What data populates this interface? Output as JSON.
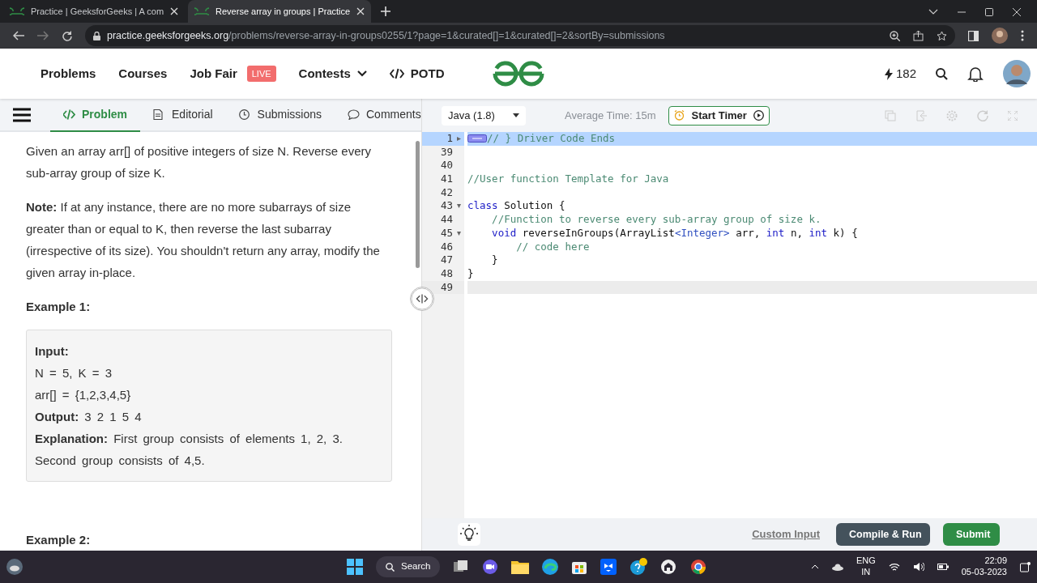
{
  "browser": {
    "tabs": [
      {
        "title": "Practice | GeeksforGeeks | A com",
        "selected": false
      },
      {
        "title": "Reverse array in groups | Practice",
        "selected": true
      }
    ],
    "url": {
      "host": "practice.geeksforgeeks.org",
      "path": "/problems/reverse-array-in-groups0255/1?page=1&curated[]=1&curated[]=2&sortBy=submissions"
    }
  },
  "header": {
    "nav": [
      {
        "label": "Problems",
        "kind": "plain"
      },
      {
        "label": "Courses",
        "kind": "plain"
      },
      {
        "label": "Job Fair",
        "kind": "badge",
        "badge": "LIVE"
      },
      {
        "label": "Contests",
        "kind": "dropdown"
      },
      {
        "label": "POTD",
        "kind": "code"
      }
    ],
    "streak": "182"
  },
  "problem_tabs": [
    {
      "label": "Problem",
      "kind": "code",
      "selected": true
    },
    {
      "label": "Editorial",
      "kind": "document",
      "selected": false
    },
    {
      "label": "Submissions",
      "kind": "clock",
      "selected": false
    },
    {
      "label": "Comments",
      "kind": "comment",
      "selected": false
    }
  ],
  "statement": {
    "paragraphs": [
      "Given an array arr[] of positive integers of size N. Reverse every sub-array group of size K.",
      "**Note:** If at any instance, there are no more subarrays of size greater than or equal to K, then reverse the last subarray (irrespective of its size). You shouldn't return any array, modify the given array in-place."
    ],
    "examples": [
      {
        "title": "Example 1:",
        "lines": [
          "**Input:**",
          "N = 5, K = 3",
          "arr[] = {1,2,3,4,5}",
          "**Output:** 3 2 1 5 4",
          "**Explanation:** First group consists of elements 1, 2, 3. Second group consists of 4,5."
        ]
      },
      {
        "title": "Example 2:"
      }
    ]
  },
  "editor": {
    "language": "Java (1.8)",
    "average_time": "Average Time: 15m",
    "timer_button": "Start Timer",
    "lines": [
      {
        "number": "1",
        "collapsed": true,
        "selected": true,
        "tokens": [
          {
            "text": "// } Driver Code Ends",
            "kind": "comment"
          }
        ]
      },
      {
        "number": "39",
        "selected": false
      },
      {
        "number": "40",
        "selected": false
      },
      {
        "number": "41",
        "selected": false,
        "tokens": [
          {
            "text": "//User function Template for Java",
            "kind": "comment"
          }
        ]
      },
      {
        "number": "42",
        "selected": false
      },
      {
        "number": "43",
        "collapsed": false,
        "selected": false,
        "tokens": [
          {
            "text": "class",
            "kind": "keyword"
          },
          {
            "text": " Solution {",
            "kind": "plain"
          }
        ]
      },
      {
        "number": "44",
        "selected": false,
        "tokens": [
          {
            "text": "    //Function to reverse every sub-array group of size k.",
            "kind": "comment"
          }
        ]
      },
      {
        "number": "45",
        "collapsed": false,
        "selected": false,
        "tokens": [
          {
            "text": "    void",
            "kind": "keyword"
          },
          {
            "text": " reverseInGroups(ArrayList",
            "kind": "plain"
          },
          {
            "text": "<Integer>",
            "kind": "type"
          },
          {
            "text": " arr, ",
            "kind": "plain"
          },
          {
            "text": "int",
            "kind": "keyword"
          },
          {
            "text": " n, ",
            "kind": "plain"
          },
          {
            "text": "int",
            "kind": "keyword"
          },
          {
            "text": " k) {",
            "kind": "plain"
          }
        ]
      },
      {
        "number": "46",
        "selected": false,
        "tokens": [
          {
            "text": "        // code here",
            "kind": "comment"
          }
        ]
      },
      {
        "number": "47",
        "selected": false,
        "tokens": [
          {
            "text": "    }",
            "kind": "plain"
          }
        ]
      },
      {
        "number": "48",
        "selected": false,
        "tokens": [
          {
            "text": "}",
            "kind": "plain"
          }
        ]
      },
      {
        "number": "49",
        "selected": false,
        "cursor": true
      }
    ]
  },
  "footer": {
    "custom_input": "Custom Input",
    "compile": "Compile & Run",
    "submit": "Submit"
  },
  "taskbar": {
    "search": "Search",
    "language": "ENG",
    "region": "IN",
    "time": "22:09",
    "date": "05-03-2023"
  }
}
